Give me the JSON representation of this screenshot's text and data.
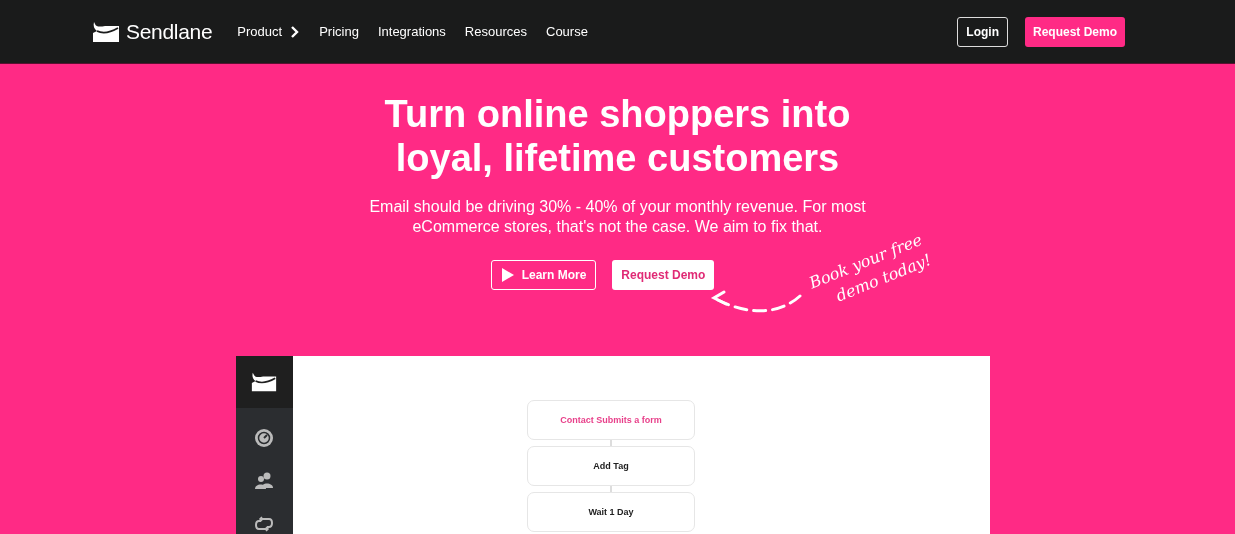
{
  "nav": {
    "brand": "Sendlane",
    "links": [
      {
        "label": "Product",
        "has_submenu": true
      },
      {
        "label": "Pricing",
        "has_submenu": false
      },
      {
        "label": "Integrations",
        "has_submenu": false
      },
      {
        "label": "Resources",
        "has_submenu": false
      },
      {
        "label": "Course",
        "has_submenu": false
      }
    ],
    "login": "Login",
    "cta": "Request Demo"
  },
  "hero": {
    "heading_lines": [
      "Turn online shoppers into",
      "loyal, lifetime customers"
    ],
    "subtext": "Email should be driving 30% - 40% of your monthly revenue. For most eCommerce stores, that's not the case. We aim to fix that.",
    "buttons": [
      {
        "label": "Learn More",
        "kind": "outline"
      },
      {
        "label": "Request Demo",
        "kind": "solid"
      }
    ],
    "note_lines": [
      "Book your free",
      "demo today!"
    ]
  },
  "app_preview": {
    "sidebar_icons": [
      {
        "kind": "gauge"
      },
      {
        "kind": "people"
      },
      {
        "kind": "loop"
      }
    ],
    "flow": [
      {
        "label": "Contact Submits a form",
        "kind": "trigger"
      },
      {
        "label": "Add Tag",
        "kind": "action"
      },
      {
        "label": "Wait 1 Day",
        "kind": "action"
      }
    ]
  }
}
